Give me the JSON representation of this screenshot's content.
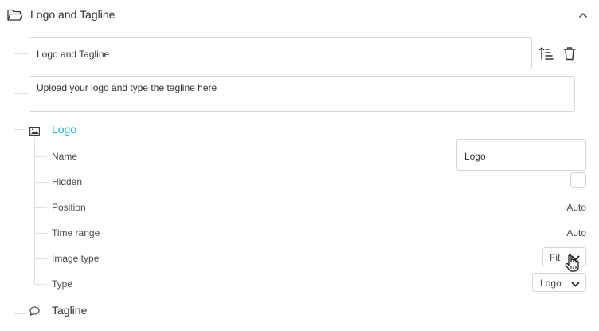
{
  "section": {
    "title": "Logo and Tagline",
    "icon": "folder-open-icon",
    "collapse_icon": "chevron-up-icon"
  },
  "fields": {
    "title_value": "Logo and Tagline",
    "description_value": "Upload your logo and type the tagline here"
  },
  "toolbar": {
    "sort_icon": "sort-icon",
    "delete_icon": "trash-icon"
  },
  "logo_node": {
    "title": "Logo",
    "icon": "image-icon",
    "accent_color": "#1fb5c4",
    "properties": {
      "name_label": "Name",
      "name_value": "Logo",
      "hidden_label": "Hidden",
      "hidden_checked": false,
      "position_label": "Position",
      "position_value": "Auto",
      "time_range_label": "Time range",
      "time_range_value": "Auto",
      "image_type_label": "Image type",
      "image_type_value": "Fit",
      "type_label": "Type",
      "type_value": "Logo"
    }
  },
  "tagline_node": {
    "title": "Tagline",
    "icon": "speech-bubble-icon"
  }
}
